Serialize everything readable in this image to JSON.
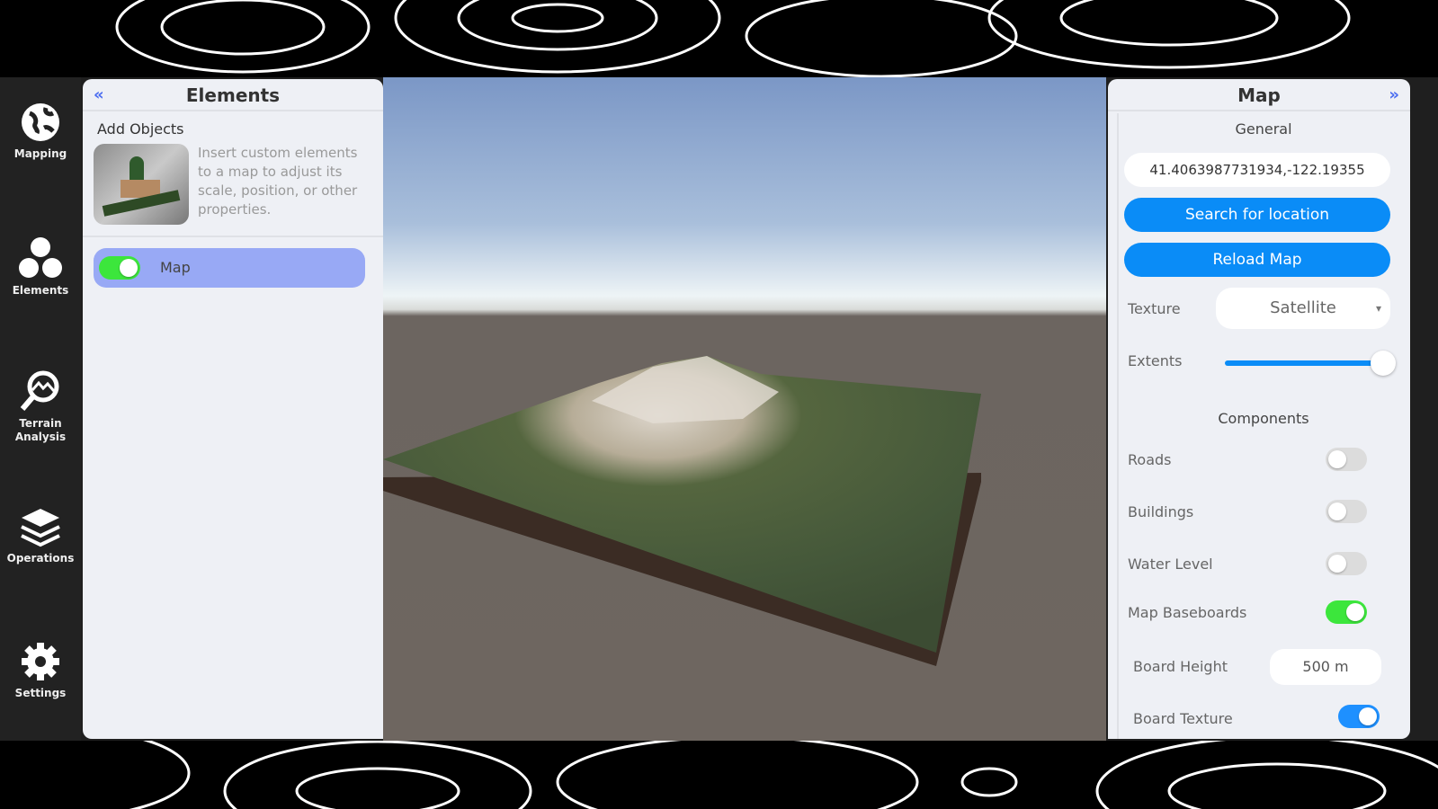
{
  "nav": [
    {
      "label": "Mapping",
      "icon": "globe-icon"
    },
    {
      "label": "Elements",
      "icon": "circles-icon"
    },
    {
      "label": "Terrain Analysis",
      "icon": "terrain-search-icon"
    },
    {
      "label": "Operations",
      "icon": "layers-icon"
    },
    {
      "label": "Settings",
      "icon": "gear-icon"
    }
  ],
  "left": {
    "title": "Elements",
    "add_title": "Add Objects",
    "add_desc": "Insert custom elements to a map to adjust its scale, position, or other properties.",
    "item": {
      "label": "Map",
      "enabled": true
    }
  },
  "right": {
    "title": "Map",
    "general": "General",
    "coords": "41.4063987731934,-122.19355",
    "search_btn": "Search for location",
    "reload_btn": "Reload Map",
    "texture_label": "Texture",
    "texture_value": "Satellite",
    "extents_label": "Extents",
    "extents_value": 0.95,
    "components": "Components",
    "toggles": [
      {
        "label": "Roads",
        "on": false
      },
      {
        "label": "Buildings",
        "on": false
      },
      {
        "label": "Water Level",
        "on": false
      },
      {
        "label": "Map Baseboards",
        "on": true
      }
    ],
    "board_height_label": "Board Height",
    "board_height": "500 m",
    "board_texture_label": "Board Texture",
    "board_texture_on": true
  },
  "colors": {
    "accent": "#0a8cf7",
    "toggle_on": "#3ce63c",
    "selected": "#98a9f5"
  }
}
